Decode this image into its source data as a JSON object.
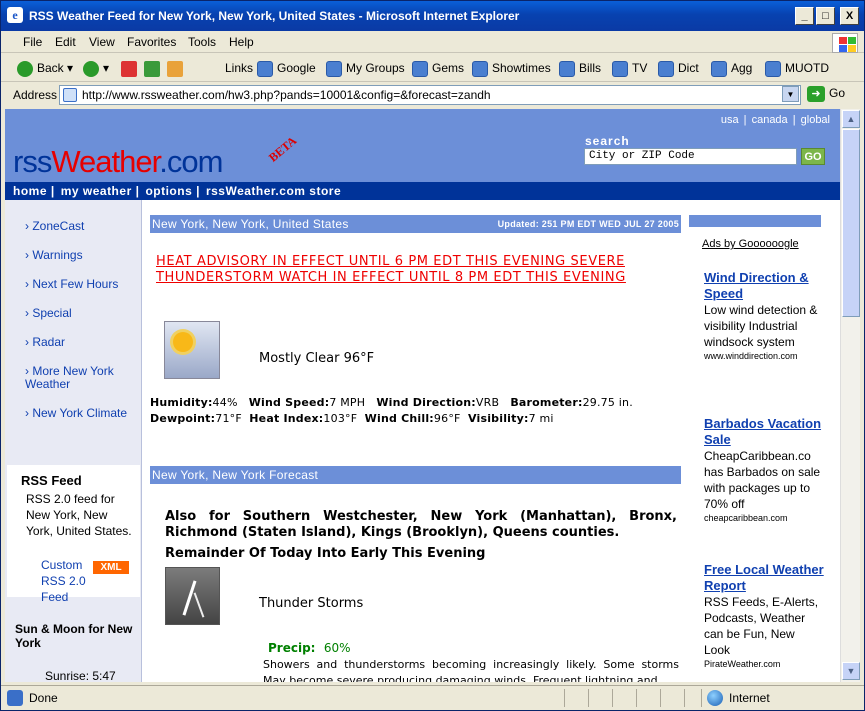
{
  "window": {
    "title": "RSS Weather Feed for New York, New York, United States - Microsoft Internet Explorer",
    "min": "_",
    "max": "□",
    "close": "X"
  },
  "menu": [
    "File",
    "Edit",
    "View",
    "Favorites",
    "Tools",
    "Help"
  ],
  "toolbar": {
    "back": "Back",
    "links_label": "Links",
    "links": [
      "Google",
      "My Groups",
      "Gems",
      "Showtimes",
      "Bills",
      "TV",
      "Dict",
      "Agg",
      "MUOTD"
    ]
  },
  "address": {
    "label": "Address",
    "url": "http://www.rssweather.com/hw3.php?pands=10001&config=&forecast=zandh",
    "go": "Go"
  },
  "status": {
    "text": "Done",
    "zone": "Internet"
  },
  "site": {
    "toplinks": "usa | canada | global",
    "logo_a": "rss",
    "logo_b": "Weather",
    "logo_c": ".com",
    "beta": "BETA",
    "search_label": "search",
    "search_placeholder": "City or ZIP Code",
    "go_btn": "GO",
    "nav": [
      "home |",
      "my weather |",
      "options |",
      "rssWeather.com store"
    ]
  },
  "left": {
    "items": [
      "› ZoneCast",
      "› Warnings",
      "› Next Few Hours",
      "› Special",
      "› Radar",
      "› More New York Weather",
      "› New York Climate"
    ],
    "rss_title": "RSS Feed",
    "rss_text": "RSS 2.0 feed for New York, New York, United States.",
    "rss_custom": "Custom",
    "rss_20": "RSS 2.0",
    "rss_feed": "Feed",
    "xml": "XML",
    "sun_head": "Sun & Moon for New York",
    "sunrise": "Sunrise: 5:47"
  },
  "main": {
    "location_bar": "New York, New York, United States",
    "updated": "Updated: 251 PM EDT WED JUL 27 2005",
    "advisory1": "HEAT ADVISORY IN EFFECT UNTIL 6 PM EDT THIS EVENING SEVERE",
    "advisory2": "THUNDERSTORM WATCH IN EFFECT UNTIL 8 PM EDT THIS EVENING",
    "condition": "Mostly Clear 96°F",
    "humidity_l": "Humidity:",
    "humidity": "44%",
    "wind_l": "Wind Speed:",
    "wind": "7 MPH",
    "dir_l": "Wind Direction:",
    "dir": "VRB",
    "baro_l": "Barometer:",
    "baro": "29.75 in.",
    "dew_l": "Dewpoint:",
    "dew": "71°F",
    "heat_l": "Heat Index:",
    "heat": "103°F",
    "chill_l": "Wind Chill:",
    "chill": "96°F",
    "vis_l": "Visibility:",
    "vis": "7 mi",
    "forecast_bar": "New York, New York Forecast",
    "also": "Also for Southern Westchester, New York (Manhattan), Bronx, Richmond (Staten Island), Kings (Brooklyn), Queens counties.",
    "remainder": "Remainder Of Today Into Early This Evening",
    "storm": "Thunder Storms",
    "precip_l": "Precip:",
    "precip": "60%",
    "detail": "Showers and thunderstorms becoming increasingly likely. Some storms May become severe producing damaging winds. Frequent lightning and"
  },
  "ads": {
    "head": "Ads by Goooooogle",
    "items": [
      {
        "title": "Wind Direction & Speed",
        "desc": "Low wind detection & visibility Industrial windsock system",
        "url": "www.winddirection.com"
      },
      {
        "title": "Barbados Vacation Sale",
        "desc": "CheapCaribbean.co has Barbados on sale with packages up to 70% off",
        "url": "cheapcaribbean.com"
      },
      {
        "title": "Free Local Weather Report",
        "desc": "RSS Feeds, E-Alerts, Podcasts, Weather can be Fun, New Look",
        "url": "PirateWeather.com"
      }
    ]
  }
}
